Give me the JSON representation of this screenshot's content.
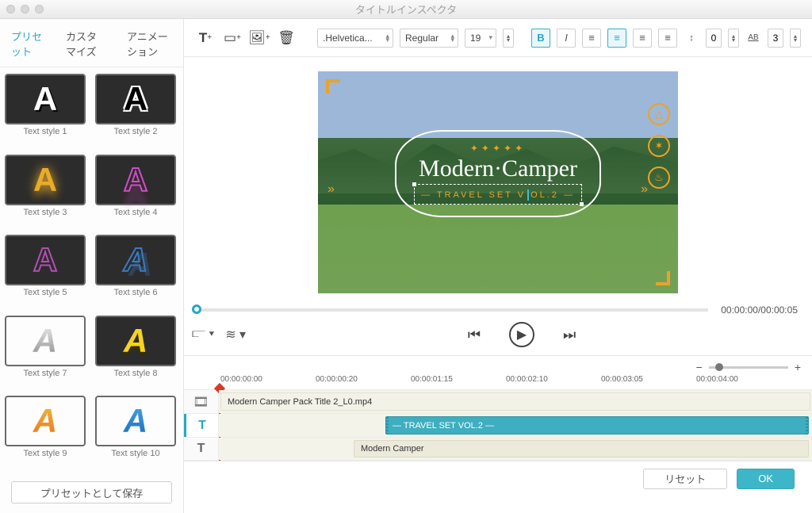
{
  "window": {
    "title": "タイトルインスペクタ"
  },
  "sidebar": {
    "tabs": [
      {
        "label": "プリセット",
        "active": true
      },
      {
        "label": "カスタマイズ"
      },
      {
        "label": "アニメーション"
      }
    ],
    "presets": [
      {
        "label": "Text style 1"
      },
      {
        "label": "Text style 2"
      },
      {
        "label": "Text style 3"
      },
      {
        "label": "Text style 4"
      },
      {
        "label": "Text style 5"
      },
      {
        "label": "Text style 6"
      },
      {
        "label": "Text style 7"
      },
      {
        "label": "Text style 8"
      },
      {
        "label": "Text style 9"
      },
      {
        "label": "Text style 10"
      }
    ],
    "save_preset": "プリセットとして保存"
  },
  "toolbar": {
    "font": ".Helvetica...",
    "weight": "Regular",
    "size": "19",
    "line_h": "0",
    "char_sp": "3"
  },
  "preview": {
    "badge_trees": "✦✦✦✦✦",
    "main_title": "Modern·Camper",
    "subtitle_full": "— TRAVEL SET VOL.2 —"
  },
  "timecode": "00:00:00/00:00:05",
  "ruler": [
    "00:00:00:00",
    "00:00:00:20",
    "00:00:01:15",
    "00:00:02:10",
    "00:00:03:05",
    "00:00:04:00"
  ],
  "tracks": {
    "video_clip": "Modern Camper Pack Title 2_L0.mp4",
    "text_clip_1": "— TRAVEL SET VOL.2 —",
    "text_clip_2": "Modern Camper"
  },
  "footer": {
    "reset": "リセット",
    "ok": "OK"
  }
}
